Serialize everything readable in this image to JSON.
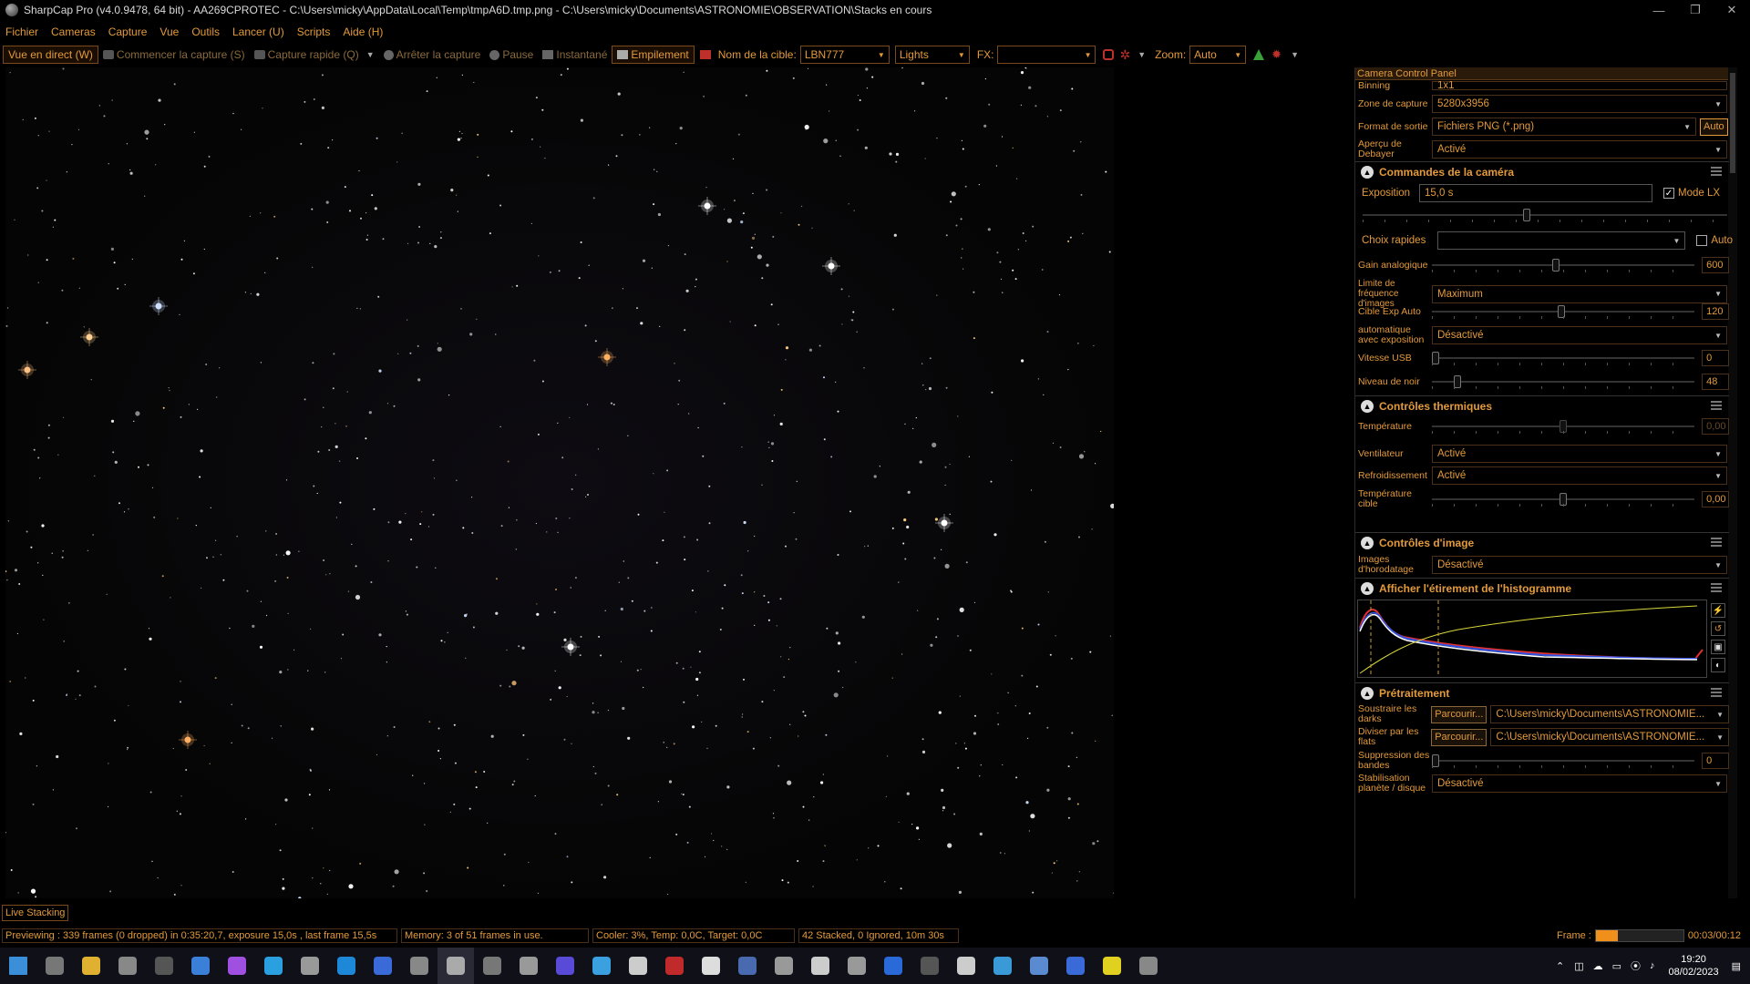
{
  "window": {
    "title": "SharpCap Pro (v4.0.9478, 64 bit) - AA269CPROTEC - C:\\Users\\micky\\AppData\\Local\\Temp\\tmpA6D.tmp.png - C:\\Users\\micky\\Documents\\ASTRONOMIE\\OBSERVATION\\Stacks en cours",
    "minimize": "—",
    "maximize": "❐",
    "close": "✕"
  },
  "menu": [
    "Fichier",
    "Cameras",
    "Capture",
    "Vue",
    "Outils",
    "Lancer (U)",
    "Scripts",
    "Aide (H)"
  ],
  "toolbar": {
    "live_view": "Vue en direct (W)",
    "start_capture": "Commencer la capture (S)",
    "quick_capture": "Capture rapide (Q)",
    "stop_capture": "Arrêter la capture",
    "pause": "Pause",
    "snapshot": "Instantané",
    "stacking": "Empilement",
    "target_label": "Nom de la cible:",
    "target_value": "LBN777",
    "frame_type": "Lights",
    "fx_label": "FX:",
    "fx_value": "",
    "zoom_label": "Zoom:",
    "zoom_value": "Auto"
  },
  "panel": {
    "header": "Camera Control Panel",
    "binning": {
      "label": "Binning",
      "value": "1x1"
    },
    "capture_area": {
      "label": "Zone de capture",
      "value": "5280x3956"
    },
    "output_format": {
      "label": "Format de sortie",
      "value": "Fichiers PNG (*.png)",
      "auto": "Auto"
    },
    "debayer_preview": {
      "label": "Aperçu de Debayer",
      "value": "Activé"
    },
    "camera_controls": {
      "title": "Commandes de la caméra",
      "exposure_label": "Exposition",
      "exposure_value": "15,0 s",
      "lx_mode": "Mode LX",
      "quick_choice_label": "Choix rapides",
      "quick_choice_auto": "Auto",
      "gain_label": "Gain analogique",
      "gain_value": "600",
      "frame_rate_label": "Limite de fréquence d'images",
      "frame_rate_value": "Maximum",
      "auto_exp_target_label": "Cible Exp Auto",
      "auto_exp_target_value": "120",
      "auto_with_exposure_label": "automatique avec exposition",
      "auto_with_exposure_value": "Désactivé",
      "usb_speed_label": "Vitesse USB",
      "usb_speed_value": "0",
      "black_level_label": "Niveau de noir",
      "black_level_value": "48"
    },
    "thermal_controls": {
      "title": "Contrôles thermiques",
      "temperature_label": "Température",
      "temperature_value": "0,00",
      "fan_label": "Ventilateur",
      "fan_value": "Activé",
      "cooling_label": "Refroidissement",
      "cooling_value": "Activé",
      "target_temp_label": "Température cible",
      "target_temp_value": "0,00"
    },
    "image_controls": {
      "title": "Contrôles d'image",
      "timestamp_label": "Images d'horodatage",
      "timestamp_value": "Désactivé"
    },
    "histogram": {
      "title": "Afficher l'étirement de l'histogramme"
    },
    "preprocessing": {
      "title": "Prétraitement",
      "darks_label": "Soustraire les darks",
      "browse": "Parcourir...",
      "darks_path": "C:\\Users\\micky\\Documents\\ASTRONOMIE...",
      "flats_label": "Diviser par les flats",
      "flats_path": "C:\\Users\\micky\\Documents\\ASTRONOMIE...",
      "banding_label": "Suppression des bandes",
      "banding_value": "0",
      "stabilization_label": "Stabilisation planète / disque",
      "stabilization_value": "Désactivé"
    }
  },
  "live_stacking": "Live Stacking",
  "status": {
    "preview": "Previewing : 339 frames (0 dropped) in 0:35:20,7, exposure 15,0s , last frame 15,5s",
    "memory": "Memory: 3 of 51 frames in use.",
    "cooler": "Cooler: 3%, Temp: 0,0C, Target: 0,0C",
    "stacked": "42 Stacked, 0 Ignored, 10m 30s",
    "frame_label": "Frame :",
    "frame_time": "00:03/00:12",
    "frame_progress": 0.25
  },
  "tray": {
    "time": "19:20",
    "date": "08/02/2023"
  },
  "taskbar_icons": [
    "windows-start-icon",
    "task-view-icon",
    "file-explorer-icon",
    "settings-icon",
    "notion-icon",
    "mail-icon",
    "messenger-icon",
    "edge-icon",
    "app-icon",
    "app-icon",
    "app-icon",
    "app-icon",
    "sharpcap-icon",
    "app-icon",
    "app-icon",
    "app-icon",
    "app-icon",
    "app-icon",
    "app-icon",
    "app-icon",
    "app-icon",
    "app-icon",
    "app-icon",
    "app-icon",
    "app-icon",
    "app-icon",
    "app-icon",
    "app-icon",
    "app-icon",
    "app-icon",
    "app-icon",
    "app-icon"
  ],
  "colors": {
    "accent": "#e39a3a",
    "border": "#7a4a1a",
    "background": "#000000"
  }
}
